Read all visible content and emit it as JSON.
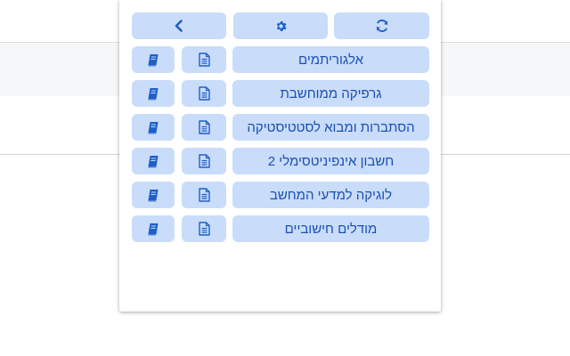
{
  "toolbar": {
    "back_icon": "chevron-left-icon",
    "settings_icon": "gear-icon",
    "refresh_icon": "refresh-icon"
  },
  "courses": [
    {
      "name": "אלגוריתמים"
    },
    {
      "name": "גרפיקה ממוחשבת"
    },
    {
      "name": "הסתברות ומבוא לסטטיסטיקה"
    },
    {
      "name": "חשבון אינפיניטסימלי 2"
    },
    {
      "name": "לוגיקה למדעי המחשב"
    },
    {
      "name": "מודלים חישוביים"
    }
  ],
  "row_icons": {
    "book": "book-icon",
    "document": "document-icon"
  },
  "colors": {
    "button_bg": "#c9dcf9",
    "icon": "#1f5fc8",
    "text": "#1a4fb3"
  }
}
